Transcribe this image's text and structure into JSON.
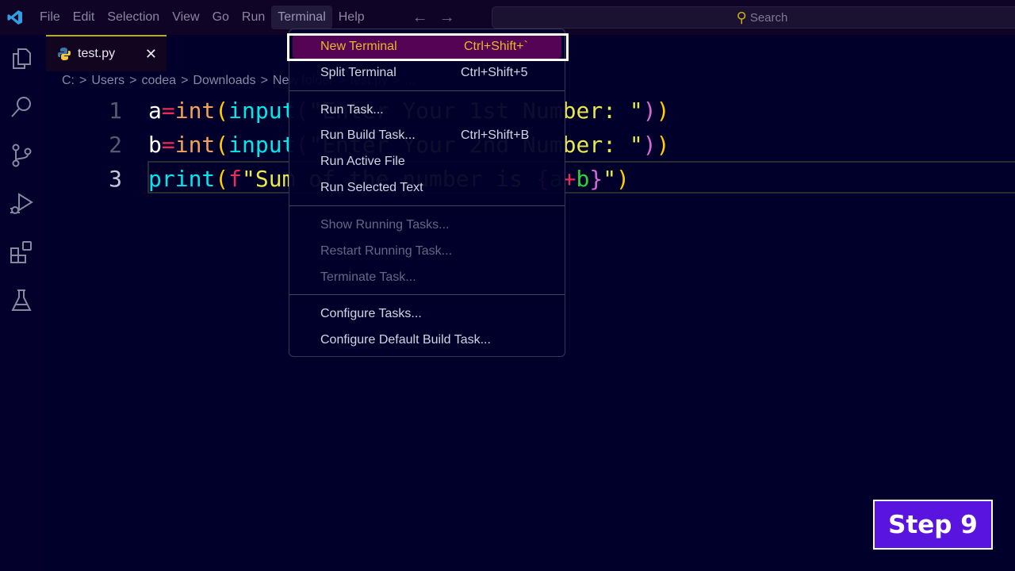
{
  "menubar": {
    "items": [
      "File",
      "Edit",
      "Selection",
      "View",
      "Go",
      "Run",
      "Terminal",
      "Help"
    ],
    "active": "Terminal",
    "search_placeholder": "Search",
    "back_icon": "arrow-left-icon",
    "forward_icon": "arrow-right-icon"
  },
  "activity_bar": [
    "explorer-icon",
    "search-icon",
    "source-control-icon",
    "run-debug-icon",
    "extensions-icon",
    "testing-icon"
  ],
  "tab": {
    "name": "test.py",
    "close": "✕",
    "icon": "python-icon"
  },
  "breadcrumb": [
    "C:",
    ">",
    "Users",
    ">",
    "codea",
    ">",
    "Downloads",
    ">",
    "New folder",
    ">",
    "test.py",
    ">",
    "..."
  ],
  "editor": {
    "line_numbers": [
      "1",
      "2",
      "3"
    ],
    "current_line": 3,
    "lines": [
      [
        [
          "a",
          "w"
        ],
        [
          "=",
          "r"
        ],
        [
          "int",
          "o"
        ],
        [
          "(",
          "y"
        ],
        [
          "input",
          "c"
        ],
        [
          "(",
          "p"
        ],
        [
          "\"Enter Your 1st Number: \"",
          "s"
        ],
        [
          ")",
          "p"
        ],
        [
          ")",
          "y"
        ]
      ],
      [
        [
          "b",
          "w"
        ],
        [
          "=",
          "r"
        ],
        [
          "int",
          "o"
        ],
        [
          "(",
          "y"
        ],
        [
          "input",
          "c"
        ],
        [
          "(",
          "p"
        ],
        [
          "\"Enter Your 2nd Number: \"",
          "s"
        ],
        [
          ")",
          "p"
        ],
        [
          ")",
          "y"
        ]
      ],
      [
        [
          "print",
          "c"
        ],
        [
          "(",
          "y"
        ],
        [
          "f",
          "r"
        ],
        [
          "\"Sum of the number is ",
          "s"
        ],
        [
          "{",
          "p"
        ],
        [
          "a",
          "g"
        ],
        [
          "+",
          "r"
        ],
        [
          "b",
          "g"
        ],
        [
          "}",
          "p"
        ],
        [
          "\"",
          "s"
        ],
        [
          ")",
          "y"
        ]
      ]
    ]
  },
  "terminal_menu": {
    "items": [
      {
        "label": "New Terminal",
        "shortcut": "Ctrl+Shift+`",
        "highlighted": true,
        "disabled": false
      },
      {
        "label": "Split Terminal",
        "shortcut": "Ctrl+Shift+5",
        "disabled": false
      },
      {
        "label": "Run Task...",
        "shortcut": "",
        "disabled": false
      },
      {
        "label": "Run Build Task...",
        "shortcut": "Ctrl+Shift+B",
        "disabled": false
      },
      {
        "label": "Run Active File",
        "shortcut": "",
        "disabled": false
      },
      {
        "label": "Run Selected Text",
        "shortcut": "",
        "disabled": false
      },
      {
        "label": "Show Running Tasks...",
        "shortcut": "",
        "disabled": true
      },
      {
        "label": "Restart Running Task...",
        "shortcut": "",
        "disabled": true
      },
      {
        "label": "Terminate Task...",
        "shortcut": "",
        "disabled": true
      },
      {
        "label": "Configure Tasks...",
        "shortcut": "",
        "disabled": false
      },
      {
        "label": "Configure Default Build Task...",
        "shortcut": "",
        "disabled": false
      }
    ]
  },
  "step_badge": "Step 9",
  "colors": {
    "accent": "#5a14e0",
    "highlight": "#5b0457",
    "highlight_text": "#f7c227"
  }
}
